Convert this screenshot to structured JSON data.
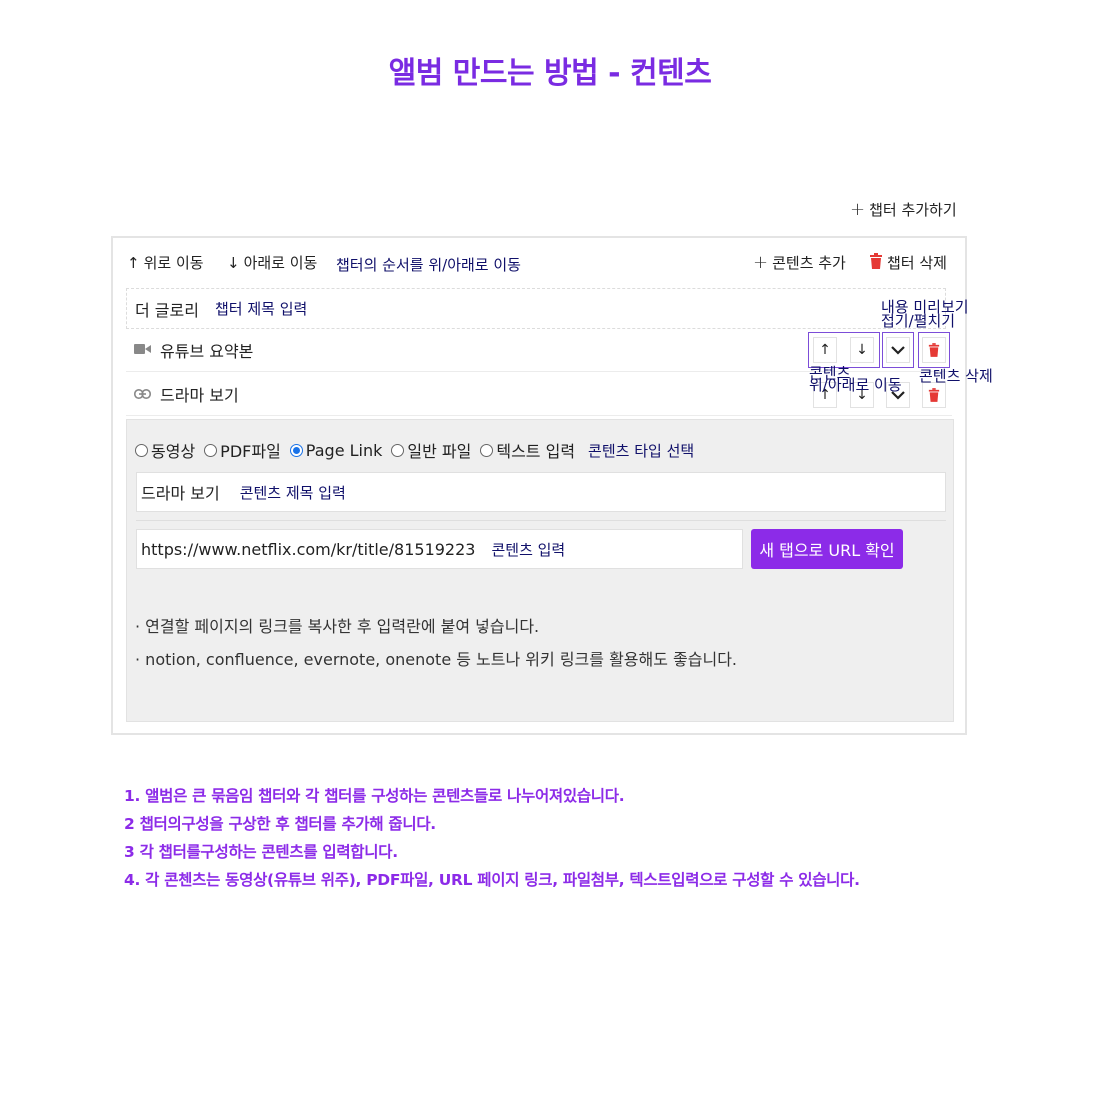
{
  "title": "앨범 만드는 방법 - 컨텐츠",
  "add_chapter": "챕터 추가하기",
  "toolbar": {
    "move_up": "위로 이동",
    "move_down": "아래로 이동",
    "order_note": "챕터의 순서를 위/아래로 이동",
    "add_content": "콘텐츠 추가",
    "delete_chapter": "챕터 삭제"
  },
  "chapter": {
    "title": "더 글로리",
    "title_note": "챕터 제목 입력"
  },
  "contents": [
    {
      "icon": "video-icon",
      "title": "유튜브 요약본"
    },
    {
      "icon": "link-icon",
      "title": "드라마 보기"
    }
  ],
  "annotations": {
    "preview": "내용 미리보기",
    "fold": "접기/펼치기",
    "content_move_1": "콘텐츠",
    "content_move_2": "위/아래로 이동",
    "content_delete": "콘텐츠 삭제"
  },
  "editor": {
    "types": [
      {
        "label": "동영상",
        "checked": false
      },
      {
        "label": "PDF파일",
        "checked": false
      },
      {
        "label": "Page Link",
        "checked": true
      },
      {
        "label": "일반 파일",
        "checked": false
      },
      {
        "label": "텍스트 입력",
        "checked": false
      }
    ],
    "type_note": "콘텐츠 타입 선택",
    "title_value": "드라마 보기",
    "title_note": "콘텐츠 제목 입력",
    "url_value": "https://www.netflix.com/kr/title/81519223",
    "url_note": "콘텐츠 입력",
    "url_button": "새 탭으로 URL 확인",
    "help": [
      "· 연결할 페이지의 링크를 복사한 후 입력란에 붙여 넣습니다.",
      "· notion, confluence, evernote, onenote 등 노트나 위키 링크를 활용해도 좋습니다."
    ]
  },
  "steps": [
    "1. 앨범은 큰 묶음임 챕터와 각 챕터를 구성하는 콘텐츠들로 나누어져있습니다.",
    "2 챕터의구성을 구상한 후 챕터를 추가해 줍니다.",
    "3 각 챕터를구성하는 콘텐츠를 입력합니다.",
    "4. 각 콘첸츠는 동영상(유튜브 위주), PDF파일, URL 페이지 링크, 파일첨부, 텍스트입력으로 구성할 수 있습니다."
  ],
  "colors": {
    "accent": "#8c2be8",
    "annotation": "#10106a",
    "delete": "#e53935",
    "panel": "#efefef"
  }
}
